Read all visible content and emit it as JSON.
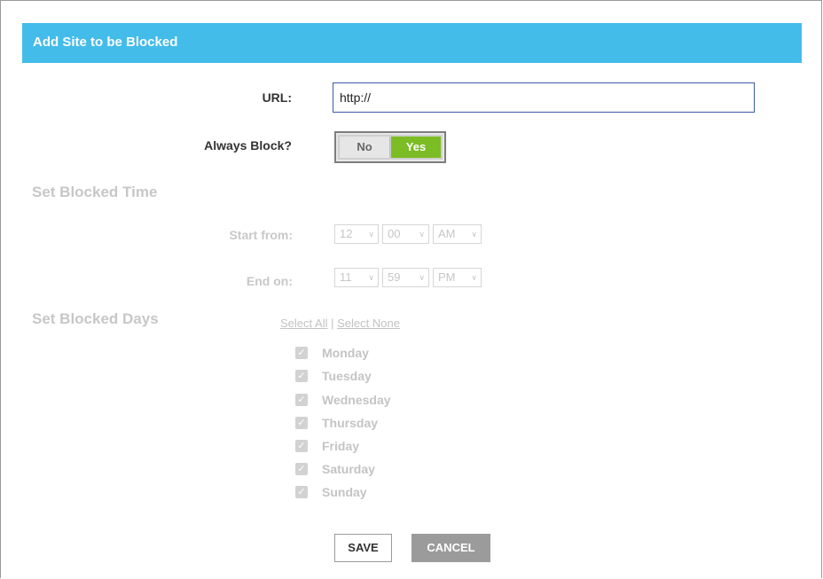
{
  "dialog": {
    "title": "Add Site to be Blocked"
  },
  "url": {
    "label": "URL:",
    "value": "http://"
  },
  "always_block": {
    "label": "Always Block?",
    "options": [
      "No",
      "Yes"
    ],
    "selected": "Yes"
  },
  "blocked_time": {
    "section_title": "Set Blocked Time",
    "start": {
      "label": "Start from:",
      "hour": "12",
      "minute": "00",
      "period": "AM"
    },
    "end": {
      "label": "End on:",
      "hour": "11",
      "minute": "59",
      "period": "PM"
    }
  },
  "blocked_days": {
    "section_title": "Set Blocked Days",
    "select_all": "Select All",
    "separator": "|",
    "select_none": "Select None",
    "days": [
      {
        "label": "Monday",
        "checked": true
      },
      {
        "label": "Tuesday",
        "checked": true
      },
      {
        "label": "Wednesday",
        "checked": true
      },
      {
        "label": "Thursday",
        "checked": true
      },
      {
        "label": "Friday",
        "checked": true
      },
      {
        "label": "Saturday",
        "checked": true
      },
      {
        "label": "Sunday",
        "checked": true
      }
    ]
  },
  "buttons": {
    "save": "SAVE",
    "cancel": "CANCEL"
  },
  "colors": {
    "header": "#43bcea",
    "toggle_active": "#7cbc24",
    "disabled_text": "#c4c4c4"
  }
}
